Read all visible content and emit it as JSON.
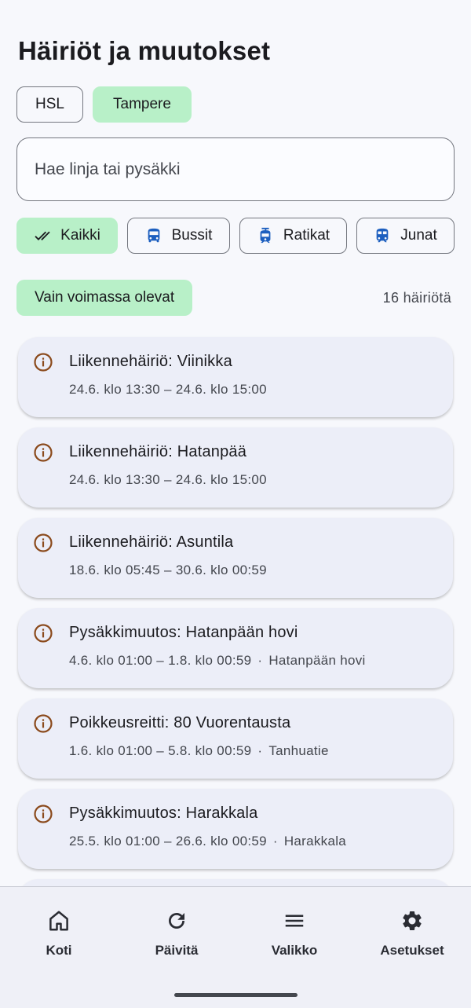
{
  "page_title": "Häiriöt ja muutokset",
  "regions": [
    {
      "label": "HSL",
      "selected": false
    },
    {
      "label": "Tampere",
      "selected": true
    }
  ],
  "search": {
    "placeholder": "Hae linja tai pysäkki",
    "value": ""
  },
  "transport_types": [
    {
      "label": "Kaikki",
      "icon": "double-check-icon",
      "selected": true
    },
    {
      "label": "Bussit",
      "icon": "bus-icon",
      "selected": false
    },
    {
      "label": "Ratikat",
      "icon": "tram-icon",
      "selected": false
    },
    {
      "label": "Junat",
      "icon": "train-icon",
      "selected": false
    }
  ],
  "filter": {
    "active_only_label": "Vain voimassa olevat",
    "count_label": "16 häiriötä"
  },
  "disruptions": [
    {
      "title": "Liikennehäiriö: Viinikka",
      "time": "24.6. klo 13:30 – 24.6. klo 15:00",
      "location": ""
    },
    {
      "title": "Liikennehäiriö: Hatanpää",
      "time": "24.6. klo 13:30 – 24.6. klo 15:00",
      "location": ""
    },
    {
      "title": "Liikennehäiriö: Asuntila",
      "time": "18.6. klo 05:45 – 30.6. klo 00:59",
      "location": ""
    },
    {
      "title": "Pysäkkimuutos: Hatanpään hovi",
      "time": "4.6. klo 01:00 – 1.8. klo 00:59",
      "location": "Hatanpään hovi"
    },
    {
      "title": "Poikkeusreitti: 80 Vuorentausta",
      "time": "1.6. klo 01:00 – 5.8. klo 00:59",
      "location": "Tanhuatie"
    },
    {
      "title": "Pysäkkimuutos: Harakkala",
      "time": "25.5. klo 01:00 – 26.6. klo 00:59",
      "location": "Harakkala"
    }
  ],
  "bottom_nav": [
    {
      "label": "Koti",
      "icon": "home-icon"
    },
    {
      "label": "Päivitä",
      "icon": "refresh-icon"
    },
    {
      "label": "Valikko",
      "icon": "menu-icon"
    },
    {
      "label": "Asetukset",
      "icon": "gear-icon"
    }
  ],
  "colors": {
    "accent_chip": "#b8f0c8",
    "info_icon": "#8b4a1c",
    "transport_icon": "#1d5fbf",
    "card_bg": "#eceef8"
  }
}
